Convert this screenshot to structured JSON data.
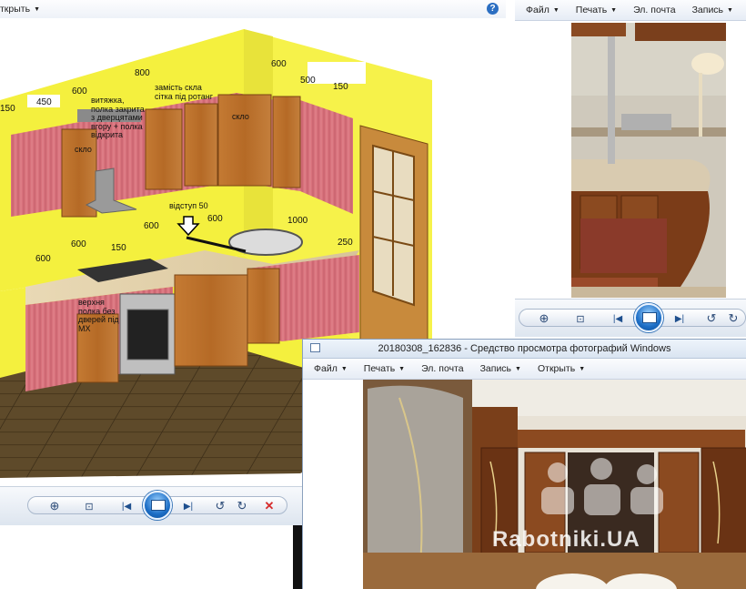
{
  "window_left": {
    "menu_partial": "ткрыть",
    "help_icon": "help-icon"
  },
  "drawing": {
    "dims": [
      "600",
      "800",
      "600",
      "450",
      "150",
      "500",
      "150",
      "600",
      "600",
      "1000",
      "600",
      "150",
      "600",
      "250"
    ],
    "notes": {
      "hood": "витяжка, полка закрита з дверцятами вгору + полка відкрита",
      "glass_instead": "замість скла сітка під ротанг",
      "glass1": "скло",
      "glass2": "скло",
      "offset": "відступ 50",
      "shelf": "верхня полка без дверей під МХ"
    }
  },
  "window_right": {
    "menu": [
      {
        "label": "Файл"
      },
      {
        "label": "Печать"
      },
      {
        "label": "Эл. почта"
      },
      {
        "label": "Запись"
      }
    ]
  },
  "window_bottom": {
    "title": "20180308_162836 - Средство просмотра фотографий Windows",
    "menu": [
      {
        "label": "Файл"
      },
      {
        "label": "Печать"
      },
      {
        "label": "Эл. почта"
      },
      {
        "label": "Запись"
      },
      {
        "label": "Открыть"
      }
    ],
    "watermark": "Rabotniki.UA"
  },
  "colors": {
    "wall_yellow": "#f3f03c",
    "cabinet_pink": "#d9737d",
    "wood": "#b36a28",
    "accent_blue": "#1d6fc7",
    "delete_red": "#d62b2b"
  }
}
